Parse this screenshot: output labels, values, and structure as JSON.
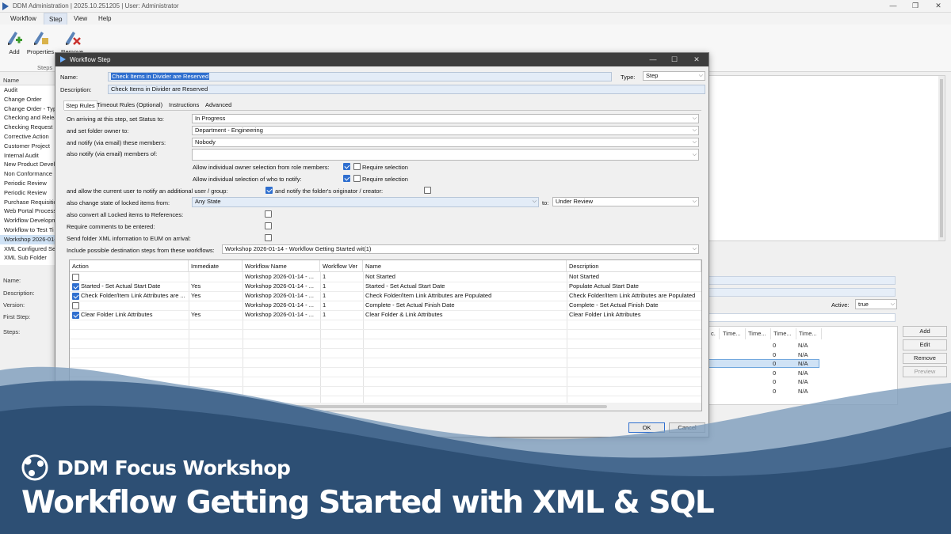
{
  "app": {
    "title": "DDM Administration | 2025.10.251205 | User: Administrator",
    "menus": [
      "Workflow",
      "Step",
      "View",
      "Help"
    ],
    "ribbon": {
      "add": "Add",
      "properties": "Properties",
      "remove": "Remove",
      "group": "Steps"
    },
    "list_header": "Name",
    "list_items": [
      "Audit",
      "Change Order",
      "Change Order - Typ",
      "Checking and Relea",
      "Checking Request",
      "Corrective Action",
      "Customer Project",
      "Internal Audit",
      "New Product Develo",
      "Non Conformance",
      "Periodic Review",
      "Periodic Review",
      "Purchase Requisitio",
      "Web Portal Process",
      "Workflow Developm",
      "Workflow to Test Ti",
      "Workshop 2026-01-1",
      "XML Configured Se",
      "XML Sub Folder"
    ],
    "details": {
      "name": "Name:",
      "description": "Description:",
      "version": "Version:",
      "first_step": "First Step:",
      "steps": "Steps:"
    },
    "active_label": "Active:",
    "active_value": "true",
    "steps_columns": [
      "Time...",
      "Time...",
      "Time...",
      "Time..."
    ],
    "steps_rows": [
      [
        "0",
        "N/A"
      ],
      [
        "0",
        "N/A"
      ],
      [
        "0",
        "N/A"
      ],
      [
        "0",
        "N/A"
      ],
      [
        "0",
        "N/A"
      ],
      [
        "0",
        "N/A"
      ]
    ],
    "side_buttons": [
      "Add",
      "Edit",
      "Remove",
      "Preview"
    ]
  },
  "dialog": {
    "title": "Workflow Step",
    "name_label": "Name:",
    "name_value": "Check Items in Divider are Reserved",
    "type_label": "Type:",
    "type_value": "Step",
    "desc_label": "Description:",
    "desc_value": "Check Items in Divider are Reserved",
    "tabs": [
      "Step Rules",
      "Timeout Rules (Optional)",
      "Instructions",
      "Advanced"
    ],
    "rules": {
      "status_label": "On arriving at this step, set Status to:",
      "status_value": "In Progress",
      "owner_label": "and set folder owner to:",
      "owner_value": "Department - Engineering",
      "notify_label": "and notify (via email) these members:",
      "notify_value": "Nobody",
      "also_notify_label": "also notify (via email) members of:",
      "allow_owner_label": "Allow individual owner selection from role members:",
      "allow_notify_label": "Allow individual selection of who to notify:",
      "require_selection": "Require selection",
      "current_user_label": "and allow the current user to notify an additional user / group:",
      "originator_label": "and notify the folder's originator / creator:",
      "change_state_label": "also change state of locked items from:",
      "change_state_from": "Any State",
      "to_label": "to:",
      "change_state_to": "Under Review",
      "convert_label": "also convert all Locked items to References:",
      "comments_label": "Require comments to be entered:",
      "xml_label": "Send folder XML information to EUM on arrival:",
      "include_label": "Include possible destination steps from these workflows:",
      "include_value": "Workshop 2026-01-14 - Workflow Getting Started wit(1)"
    },
    "grid": {
      "columns": [
        "Action",
        "Immediate",
        "Workflow Name",
        "Workflow Ver",
        "Name",
        "Description"
      ],
      "rows": [
        {
          "action": "",
          "immediate": "",
          "workflow": "Workshop 2026-01-14 - ...",
          "ver": "1",
          "name": "Not Started",
          "description": "Not Started"
        },
        {
          "action": "Started - Set Actual Start Date",
          "immediate": "Yes",
          "workflow": "Workshop 2026-01-14 - ...",
          "ver": "1",
          "name": "Started - Set Actual Start Date",
          "description": "Populate Actual Start Date"
        },
        {
          "action": "Check Folder/Item Link Attributes are ...",
          "immediate": "Yes",
          "workflow": "Workshop 2026-01-14 - ...",
          "ver": "1",
          "name": "Check Folder/Item Link Attributes are Populated",
          "description": "Check Folder/Item Link Attributes are Populated"
        },
        {
          "action": "",
          "immediate": "",
          "workflow": "Workshop 2026-01-14 - ...",
          "ver": "1",
          "name": "Complete - Set Actual Finish Date",
          "description": "Complete - Set Actual Finish Date"
        },
        {
          "action": "Clear Folder Link Attributes",
          "immediate": "Yes",
          "workflow": "Workshop 2026-01-14 - ...",
          "ver": "1",
          "name": "Clear Folder & Link Attributes",
          "description": "Clear Folder Link Attributes"
        }
      ]
    },
    "ok": "OK",
    "cancel": "Cancel"
  },
  "banner": {
    "title": "DDM Focus Workshop",
    "subtitle": "Workflow Getting Started with XML & SQL",
    "colors": {
      "band_dark": "#2d4f74",
      "band_mid": "#46698f",
      "band_light": "#7d9cbc"
    }
  }
}
